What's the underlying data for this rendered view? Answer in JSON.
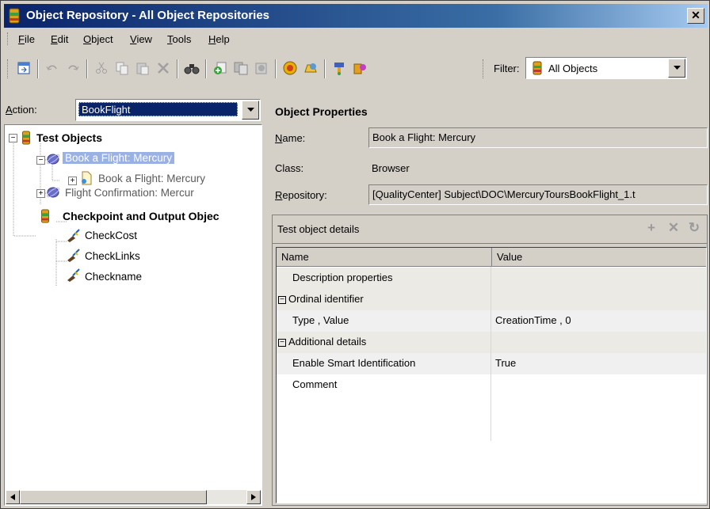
{
  "window": {
    "title": "Object Repository - All Object Repositories",
    "close_glyph": "✕"
  },
  "menu": [
    {
      "label": "File",
      "mnemonic": "F",
      "rest": "ile"
    },
    {
      "label": "Edit",
      "mnemonic": "E",
      "rest": "dit"
    },
    {
      "label": "Object",
      "mnemonic": "O",
      "rest": "bject"
    },
    {
      "label": "View",
      "mnemonic": "V",
      "rest": "iew"
    },
    {
      "label": "Tools",
      "mnemonic": "T",
      "rest": "ools"
    },
    {
      "label": "Help",
      "mnemonic": "H",
      "rest": "elp"
    }
  ],
  "toolbar": {
    "icons": [
      "export-icon",
      "undo-icon",
      "redo-icon",
      "cut-icon",
      "copy-icon",
      "paste-icon",
      "delete-icon",
      "find-icon",
      "add-objects-icon",
      "update-from-app-icon",
      "highlight-icon",
      "object-spy-icon",
      "define-test-object-icon",
      "navigate-icon",
      "add-to-local-icon"
    ],
    "filter_label": "Filter:",
    "filter_value": "All Objects"
  },
  "action": {
    "label_mnemonic": "A",
    "label_rest": "ction:",
    "value": "BookFlight"
  },
  "tree": {
    "test_objects": "Test Objects",
    "browser": "Book a Flight: Mercury",
    "page": "Book a Flight: Mercury",
    "flight_confirmation": "Flight Confirmation: Mercur",
    "checkpoints": "Checkpoint and Output Objec",
    "check_cost": "CheckCost",
    "check_links": "CheckLinks",
    "check_name": "Checkname"
  },
  "properties": {
    "title": "Object Properties",
    "name_label_mnemonic": "N",
    "name_label_rest": "ame:",
    "name_value": "Book a Flight: Mercury",
    "class_label": "Class:",
    "class_value": "Browser",
    "repo_label_mnemonic": "R",
    "repo_label_rest": "epository:",
    "repo_value": "[QualityCenter] Subject\\DOC\\MercuryToursBookFlight_1.t"
  },
  "details": {
    "title": "Test object details",
    "add_glyph": "+",
    "remove_glyph": "✕",
    "refresh_glyph": "↻",
    "col_name": "Name",
    "col_value": "Value",
    "rows": [
      {
        "name": "Description properties",
        "value": ""
      },
      {
        "name": "Ordinal identifier",
        "value": ""
      },
      {
        "name": "Type , Value",
        "value": "CreationTime , 0"
      },
      {
        "name": "Additional details",
        "value": ""
      },
      {
        "name": "Enable Smart Identification",
        "value": "True"
      },
      {
        "name": "Comment",
        "value": ""
      }
    ]
  }
}
